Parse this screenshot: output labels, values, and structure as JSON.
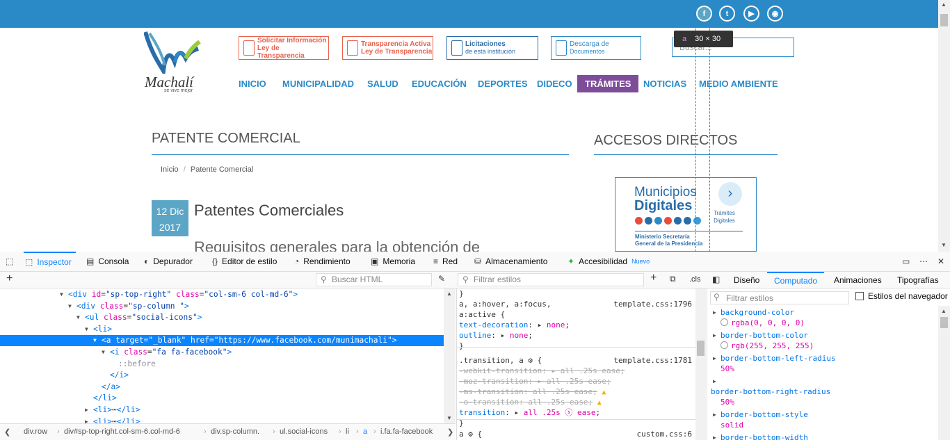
{
  "website": {
    "social": [
      "f",
      "t",
      "▶",
      "◉"
    ],
    "logo": {
      "name": "Machalí",
      "tagline": "se vive mejor"
    },
    "header_buttons": [
      {
        "line1": "Solicitar Información",
        "line2": "Ley de Transparencia",
        "color": "#e8624d"
      },
      {
        "line1": "Transparencia Activa",
        "line2": "Ley de Transparencia",
        "color": "#e8624d"
      },
      {
        "line1": "Licitaciones",
        "line2": "de esta institución",
        "color": "#2a6ca8"
      },
      {
        "line1": "Descarga de",
        "line2": "Documentos",
        "color": "#2a8ac8"
      }
    ],
    "search_placeholder": "Buscar...",
    "tooltip": {
      "tag": "a",
      "size": "30 × 30"
    },
    "nav": [
      "INICIO",
      "MUNICIPALIDAD",
      "SALUD",
      "EDUCACIÓN",
      "DEPORTES",
      "DIDECO",
      "TRÁMITES",
      "NOTICIAS",
      "MEDIO AMBIENTE"
    ],
    "nav_active": "TRÁMITES",
    "page_title": "PATENTE COMERCIAL",
    "sidebar_title": "ACCESOS DIRECTOS",
    "breadcrumb": {
      "home": "Inicio",
      "sep": "/",
      "current": "Patente Comercial"
    },
    "date": {
      "day": "12 Dic",
      "year": "2017"
    },
    "article_title": "Patentes Comerciales",
    "article_subtitle": "Requisitos generales para la obtención de",
    "municipios": {
      "line1": "Municipios",
      "line2": "Digitales",
      "ministry1": "Ministerio Secretaría",
      "ministry2": "General de la Presidencia",
      "tramites1": "Trámites",
      "tramites2": "Digitales",
      "arrow": "›",
      "dot_colors": [
        "#e84c3d",
        "#2a6ca8",
        "#2a8ac8",
        "#e84c3d",
        "#2a6ca8",
        "#2a6ca8",
        "#3a9ad9"
      ]
    }
  },
  "devtools": {
    "tabs": [
      "Inspector",
      "Consola",
      "Depurador",
      "Editor de estilo",
      "Rendimiento",
      "Memoria",
      "Red",
      "Almacenamiento",
      "Accesibilidad"
    ],
    "tab_new_badge": "Nuevo",
    "search_html_placeholder": "Buscar HTML",
    "filter_styles_placeholder": "Filtrar estilos",
    "cls": ".cls",
    "panel_tabs": [
      "Diseño",
      "Computado",
      "Animaciones",
      "Tipografías"
    ],
    "computed_filter": "Filtrar estilos",
    "browser_styles": "Estilos del navegador",
    "markup": [
      {
        "indent": 86,
        "tw": "▼",
        "html": "<span class='tg'>&lt;div</span> <span class='an'>id</span>=<span class='av'>\"sp-top-right\"</span> <span class='an'>class</span>=<span class='av'>\"col-sm-6 col-md-6\"</span><span class='tg'>&gt;</span>"
      },
      {
        "indent": 98,
        "tw": "▼",
        "html": "<span class='tg'>&lt;div</span> <span class='an'>class</span>=<span class='av'>\"sp-column \"</span><span class='tg'>&gt;</span>"
      },
      {
        "indent": 110,
        "tw": "▼",
        "html": "<span class='tg'>&lt;ul</span> <span class='an'>class</span>=<span class='av'>\"social-icons\"</span><span class='tg'>&gt;</span>"
      },
      {
        "indent": 122,
        "tw": "▼",
        "html": "<span class='tg'>&lt;li&gt;</span>"
      },
      {
        "indent": 134,
        "tw": "▼",
        "html": "<span class='tg'>&lt;a</span> <span class='an'>target</span>=<span class='av'>\"_blank\"</span> <span class='an'>href</span>=<span class='av'>\"https://www.facebook.com/munimachali\"</span><span class='tg'>&gt;</span>",
        "sel": true
      },
      {
        "indent": 146,
        "tw": "▼",
        "html": "<span class='tg'>&lt;i</span> <span class='an'>class</span>=<span class='av'>\"fa fa-facebook\"</span><span class='tg'>&gt;</span>"
      },
      {
        "indent": 158,
        "tw": "",
        "html": "<span class='tw'>::before</span>"
      },
      {
        "indent": 146,
        "tw": "",
        "html": "<span class='tg'>&lt;/i&gt;</span>"
      },
      {
        "indent": 134,
        "tw": "",
        "html": "<span class='tg'>&lt;/a&gt;</span>"
      },
      {
        "indent": 122,
        "tw": "",
        "html": "<span class='tg'>&lt;/li&gt;</span>"
      },
      {
        "indent": 122,
        "tw": "▶",
        "html": "<span class='tg'>&lt;li&gt;</span>⋯<span class='tg'>&lt;/li&gt;</span>"
      },
      {
        "indent": 122,
        "tw": "▶",
        "html": "<span class='tg'>&lt;li&gt;</span>⋯<span class='tg'>&lt;/li&gt;</span>"
      }
    ],
    "breadcrumbs": [
      "div.row",
      "div#sp-top-right.col-sm-6.col-md-6",
      "div.sp-column.",
      "ul.social-icons",
      "li",
      "a",
      "i.fa.fa-facebook"
    ],
    "rules": [
      {
        "text": "}",
        "src": ""
      },
      {
        "text": "a, a:hover, a:focus,",
        "src": "template.css:1796"
      },
      {
        "text": "a:active {",
        "src": ""
      },
      {
        "text": "  <span class='pn'>text-decoration</span>: ▸ <span class='pv'>none</span>;",
        "src": ""
      },
      {
        "text": "  <span class='pn'>outline</span>: ▸ <span class='pv'>none</span>;",
        "src": ""
      },
      {
        "text": "}",
        "src": ""
      },
      {
        "text": ".transition, a ⚙ {",
        "src": "template.css:1781"
      },
      {
        "text": "  <span class='strike'><span class='pn'>-webkit-transition</span>: ▸ <span class='pv'>all .25s ease</span>;</span>",
        "src": ""
      },
      {
        "text": "  <span class='strike'><span class='pn'>-moz-transition</span>: ▸ <span class='pv'>all .25s ease</span>;</span>",
        "src": ""
      },
      {
        "text": "  <span class='strike'><span class='pn'>-ms-transition</span>: <span class='pv'>all .25s ease</span>;</span> <span class='warn'>▲</span>",
        "src": ""
      },
      {
        "text": "  <span class='strike'><span class='pn'>-o-transition</span>: <span class='pv'>all .25s ease</span>;</span> <span class='warn'>▲</span>",
        "src": ""
      },
      {
        "text": "  <span class='pn'>transition</span>: ▸ <span class='pv'>all .25s ⓢ ease</span>;",
        "src": ""
      },
      {
        "text": "}",
        "src": ""
      },
      {
        "text": "a ⚙ {",
        "src": "custom.css:6"
      }
    ],
    "computed": [
      {
        "name": "background-color",
        "value": "rgba(0, 0, 0, 0)",
        "swatch": "rgba(0,0,0,0)"
      },
      {
        "name": "border-bottom-color",
        "value": "rgb(255, 255, 255)",
        "swatch": "#ffffff"
      },
      {
        "name": "border-bottom-left-radius",
        "value": "50%"
      },
      {
        "name": "border-bottom-right-radius",
        "value": "50%"
      },
      {
        "name": "border-bottom-style",
        "value": "solid"
      },
      {
        "name": "border-bottom-width",
        "value": ""
      }
    ]
  }
}
